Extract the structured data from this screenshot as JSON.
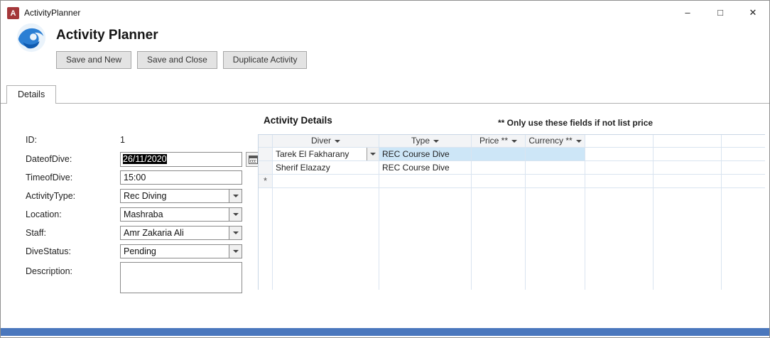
{
  "window": {
    "title": "ActivityPlanner",
    "app_icon_letter": "A",
    "controls": {
      "minimize": "–",
      "maximize": "□",
      "close": "✕"
    }
  },
  "header": {
    "title": "Activity Planner",
    "buttons": [
      "Save and New",
      "Save and Close",
      "Duplicate Activity"
    ]
  },
  "tabs": [
    {
      "label": "Details"
    }
  ],
  "form": {
    "fields": [
      {
        "label": "ID:",
        "value": "1",
        "type": "static"
      },
      {
        "label": "DateofDive:",
        "value": "26/11/2020",
        "type": "date"
      },
      {
        "label": "TimeofDive:",
        "value": "15:00",
        "type": "text"
      },
      {
        "label": "ActivityType:",
        "value": "Rec Diving",
        "type": "combo"
      },
      {
        "label": "Location:",
        "value": "Mashraba",
        "type": "combo"
      },
      {
        "label": "Staff:",
        "value": "Amr Zakaria Ali",
        "type": "combo"
      },
      {
        "label": "DiveStatus:",
        "value": "Pending",
        "type": "combo"
      },
      {
        "label": "Description:",
        "value": "",
        "type": "textarea"
      }
    ]
  },
  "subform": {
    "title": "Activity Details",
    "note": "** Only use these fields if not list price",
    "columns": [
      "Diver",
      "Type",
      "Price **",
      "Currency **"
    ],
    "rows": [
      {
        "diver": "Tarek El Fakharany",
        "type": "REC Course Dive",
        "price": "",
        "currency": "",
        "selected": true
      },
      {
        "diver": "Sherif Elazazy",
        "type": "REC Course Dive",
        "price": "",
        "currency": "",
        "selected": false
      }
    ],
    "new_row_marker": "*"
  },
  "colors": {
    "app_icon": "#a4373a",
    "selection_row": "#cde6f7",
    "grid_line": "#d9e4f0",
    "status_strip": "#4a77bd"
  }
}
